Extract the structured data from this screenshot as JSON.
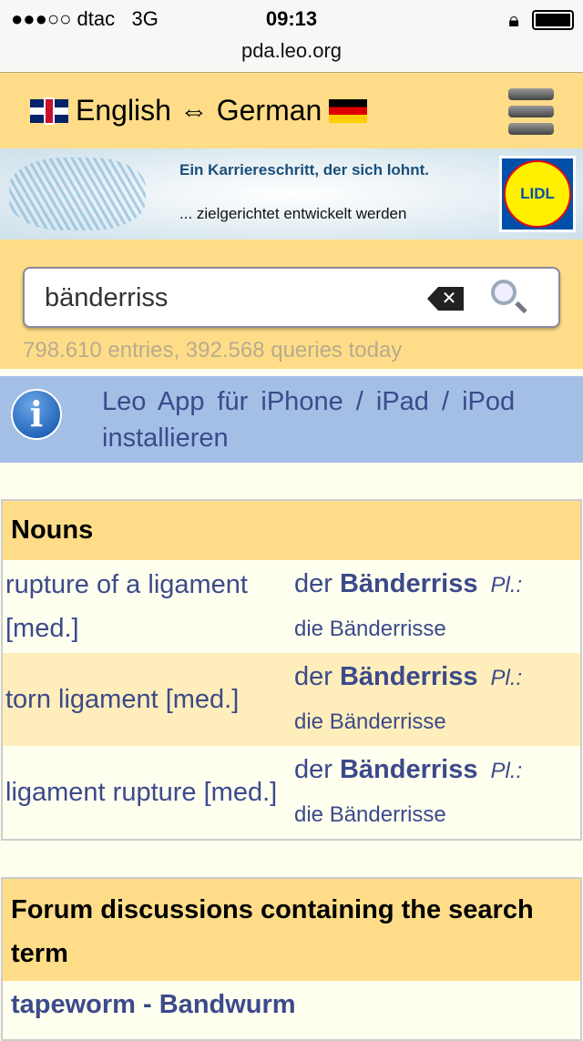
{
  "status": {
    "carrier": "●●●○○ dtac",
    "network": "3G",
    "time": "09:13"
  },
  "browser": {
    "url": "pda.leo.org"
  },
  "header": {
    "lang_from": "English",
    "arrow": "⇔",
    "lang_to": "German"
  },
  "ad": {
    "line1": "Ein Karriereschritt, der sich lohnt.",
    "line2": "... zielgerichtet entwickelt werden",
    "logo": "LIDL"
  },
  "search": {
    "value": "bänderriss",
    "clear": "✕",
    "stats": "798.610 entries, 392.568 queries today"
  },
  "info": {
    "text": "Leo App für iPhone / iPad / iPod installieren"
  },
  "nouns": {
    "title": "Nouns",
    "rows": [
      {
        "en": "rupture of a ligament [med.]",
        "article": "der",
        "de": "Bänderriss",
        "pl_label": "Pl.:",
        "plural": "die Bänderrisse"
      },
      {
        "en": "torn ligament [med.]",
        "article": "der",
        "de": "Bänderriss",
        "pl_label": "Pl.:",
        "plural": "die Bänderrisse"
      },
      {
        "en": "ligament rupture [med.]",
        "article": "der",
        "de": "Bänderriss",
        "pl_label": "Pl.:",
        "plural": "die Bänderrisse"
      }
    ]
  },
  "forum": {
    "title": "Forum discussions containing the search term",
    "items": [
      "tapeworm - Bandwurm"
    ]
  }
}
